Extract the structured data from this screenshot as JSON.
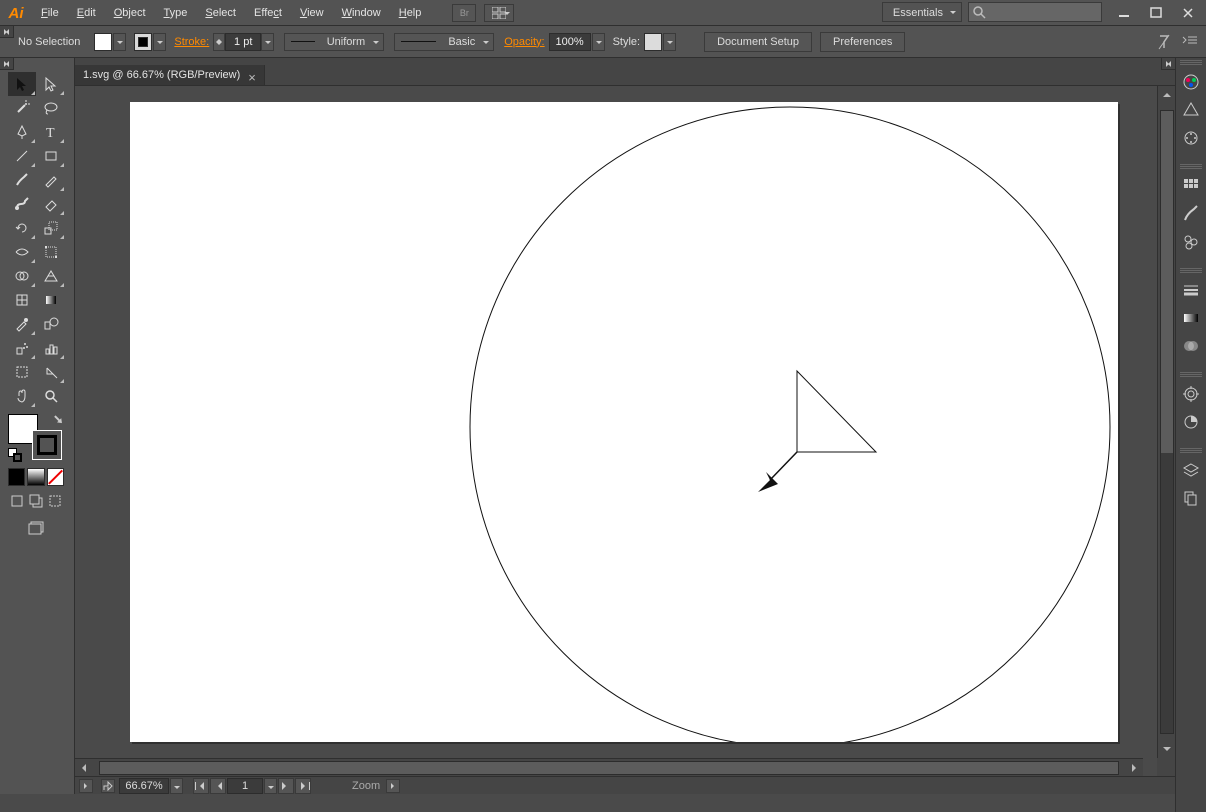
{
  "app": {
    "name": "Ai"
  },
  "menu": {
    "items": [
      "File",
      "Edit",
      "Object",
      "Type",
      "Select",
      "Effect",
      "View",
      "Window",
      "Help"
    ]
  },
  "workspace": "Essentials",
  "search_placeholder": "",
  "options": {
    "selection": "No Selection",
    "stroke_label": "Stroke:",
    "stroke_weight": "1 pt",
    "stroke_style": "Uniform",
    "brush": "Basic",
    "opacity_label": "Opacity:",
    "opacity": "100%",
    "style_label": "Style:",
    "doc_setup": "Document Setup",
    "prefs": "Preferences"
  },
  "doc_tab": "1.svg @ 66.67% (RGB/Preview)",
  "status": {
    "zoom": "66.67%",
    "page": "1",
    "tool": "Zoom"
  },
  "tools": [
    "selection",
    "direct-selection",
    "magic-wand",
    "lasso",
    "pen",
    "type",
    "line",
    "rectangle",
    "paintbrush",
    "pencil",
    "blob-brush",
    "eraser",
    "rotate",
    "scale",
    "width",
    "free-transform",
    "shape-builder",
    "perspective-grid",
    "mesh",
    "gradient",
    "eyedropper",
    "blend",
    "symbol-sprayer",
    "column-graph",
    "artboard",
    "slice",
    "hand",
    "zoom"
  ],
  "right_icons": [
    "color",
    "color-guide",
    "swatches",
    "brushes",
    "symbols",
    "stroke",
    "gradient",
    "transparency",
    "appearance",
    "graphic-styles",
    "layers",
    "artboards"
  ]
}
